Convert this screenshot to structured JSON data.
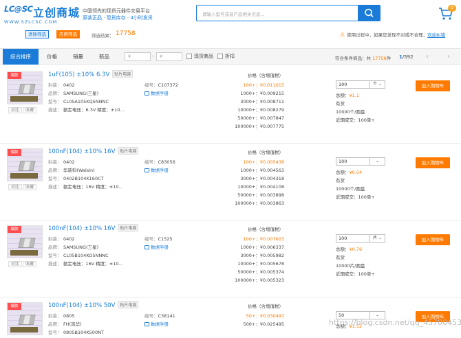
{
  "header": {
    "logo_mark": "LC@SC",
    "logo_name": "立创商城",
    "logo_url": "WWW.SZLCSC.COM",
    "slogan_line1": "中国领先的现货元器件交易平台",
    "slogan_line2": "原装正品 · 现货库存 · 4小时发货",
    "search_placeholder": "请输入型号或者产品相关信息...",
    "cart_count": "0"
  },
  "filter": {
    "clear_label": "清除筛选",
    "apply_label": "应用筛选",
    "result_label": "筛选结果：",
    "result_count": "17758",
    "notice_text": "使用过程中，如果您发现不对或不合理，",
    "notice_link": "欢迎纠错"
  },
  "sortbar": {
    "tabs": [
      "综合排序",
      "价格",
      "销量",
      "新品"
    ],
    "price_from_placeholder": "¥",
    "price_to_placeholder": "¥",
    "stock_label": "现货商品",
    "discount_label": "折扣",
    "total_prefix": "符合条件商品：共",
    "total_count": "17758",
    "total_suffix": "件",
    "page_current": "1",
    "page_total": "/592"
  },
  "labels": {
    "hot": "爆款",
    "compare": "对比",
    "favorite": "收藏",
    "package": "封装：",
    "brand": "品牌：",
    "model": "型号：",
    "desc": "描述：",
    "code": "编号：",
    "datasheet": "数据手册",
    "price_head": "价格（含增值税）",
    "total": "总额：",
    "add_to_cart": "加入购物车"
  },
  "products": [
    {
      "title": "1uF(105) ±10% 6.3V",
      "tag": "贴片电容",
      "package": "0402",
      "brand": "SAMSUNG(三星)",
      "model": "CL05A105KQ5NNNC",
      "desc": "额定电压：6.3V 精度：±10...",
      "code": "C107372",
      "prices": [
        "100+：¥0.011015",
        "1000+：¥0.009215",
        "3000+：¥0.008711",
        "10000+：¥0.008279",
        "50000+：¥0.007847",
        "100000+：¥0.007775"
      ],
      "qty": "100",
      "unit": "个",
      "total": "¥1.1",
      "stock_status": "有货",
      "pack": "10000个/圆盘",
      "recent": "近期成交：100单+"
    },
    {
      "title": "100nF(104) ±10% 16V",
      "tag": "贴片电容",
      "package": "0402",
      "brand": "华新科(Walsin)",
      "model": "0402B104K160CT",
      "desc": "额定电压：16V 精度：±10...",
      "code": "C83056",
      "prices": [
        "100+：¥0.005438",
        "1000+：¥0.004563",
        "3000+：¥0.004318",
        "10000+：¥0.004108",
        "50000+：¥0.003898",
        "100000+：¥0.003863"
      ],
      "qty": "100",
      "unit": "",
      "total": "¥0.54",
      "stock_status": "有货",
      "pack": "10000个/圆盘",
      "recent": "近期成交：100单+"
    },
    {
      "title": "100nF(104) ±10% 16V",
      "tag": "贴片电容",
      "package": "0402",
      "brand": "SAMSUNG(三星)",
      "model": "CL05B104KO5NNNC",
      "desc": "额定电压：16V 精度：±10...",
      "code": "C1525",
      "prices": [
        "100+：¥0.007603",
        "1000+：¥0.006337",
        "3000+：¥0.005982",
        "10000+：¥0.005678",
        "50000+：¥0.005374",
        "100000+：¥0.005323"
      ],
      "qty": "100",
      "unit": "片",
      "total": "¥0.76",
      "stock_status": "有货",
      "pack": "10000片/圆盘",
      "recent": "近期成交：100单+"
    },
    {
      "title": "100nF(104) ±10% 50V",
      "tag": "贴片电容",
      "package": "0805",
      "brand": "FH(风华)",
      "model": "0805B104K500NT",
      "desc": "",
      "code": "C38141",
      "prices": [
        "50+：¥0.030497",
        "500+：¥0.025495"
      ],
      "qty": "50",
      "unit": "",
      "total": "¥1.52",
      "stock_status": "",
      "pack": "",
      "recent": ""
    }
  ],
  "watermark": "https://blog.csdn.net/qq_45700453",
  "colors": {
    "brand_blue": "#1a7cd8",
    "accent_orange": "#ff7a00"
  }
}
